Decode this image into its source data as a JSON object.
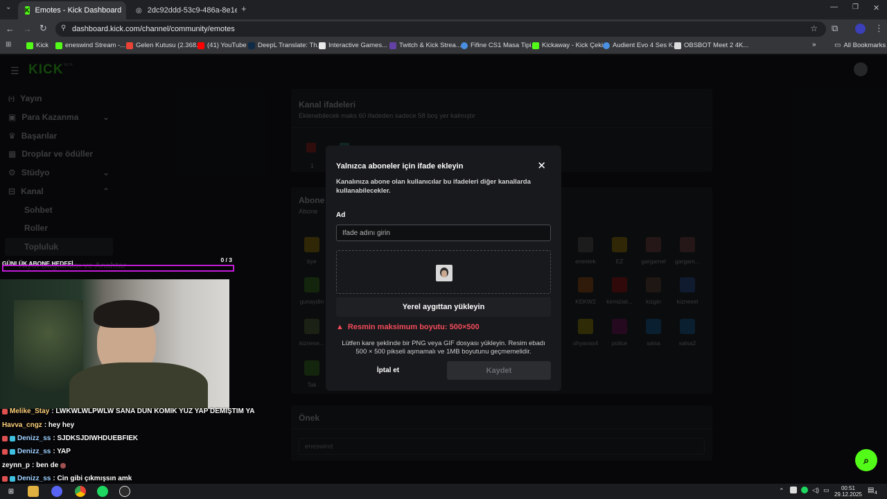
{
  "browser": {
    "tabs": [
      {
        "title": "Emotes - Kick Dashboard",
        "active": true
      },
      {
        "title": "2dc92ddd-53c9-486a-8e1e-22...",
        "active": false
      }
    ],
    "url": "dashboard.kick.com/channel/community/emotes",
    "bookmarks": [
      "Kick",
      "eneswind Stream -...",
      "Gelen Kutusu (2.368...",
      "(41) YouTube",
      "DeepL Translate: Th...",
      "Interactive Games...",
      "Twitch & Kick Strea...",
      "Fifine CS1 Masa Tipi...",
      "Kickaway - Kick Çeki...",
      "Audient Evo 4 Ses K...",
      "OBSBOT Meet 2 4K..."
    ],
    "all_bookmarks": "All Bookmarks"
  },
  "sidebar": {
    "logo": "KICK",
    "logo_tag": "BETA",
    "items": [
      {
        "label": "Yayın",
        "icon": "broadcast-icon"
      },
      {
        "label": "Para Kazanma",
        "icon": "money-icon"
      },
      {
        "label": "Başarılar",
        "icon": "trophy-icon"
      },
      {
        "label": "Droplar ve ödüller",
        "icon": "gift-icon"
      },
      {
        "label": "Stüdyo",
        "icon": "gear-icon"
      },
      {
        "label": "Kanal",
        "icon": "channel-icon"
      }
    ],
    "subitems": [
      "Sohbet",
      "Roller",
      "Topluluk",
      "Yayın Bağlantısı ve Anahtar"
    ]
  },
  "main": {
    "channel_emotes_title": "Kanal ifadeleri",
    "channel_emotes_sub": "Eklenebilecek maks 60 ifadeden sadece 58 boş yer kalmıştır",
    "first_emote_label": "1",
    "subscriber_title": "Abone",
    "subscriber_sub": "Abone",
    "emotes_left": [
      "bye",
      "gunaydin",
      "kiznese...",
      "Tak"
    ],
    "emotes_right_row1": [
      "enestek",
      "EZ",
      "gargamel",
      "gargam..."
    ],
    "emotes_right_row2": [
      "KEKW2",
      "kirmizial...",
      "kizgin",
      "kiznesel"
    ],
    "emotes_right_row3": [
      "ohyavas4",
      "police",
      "salsa",
      "salsa2"
    ],
    "prefix_title": "Önek",
    "prefix_value": "eneswind"
  },
  "modal": {
    "title": "Yalnızca aboneler için ifade ekleyin",
    "description": "Kanalınıza abone olan kullanıcılar bu ifadeleri diğer kanallarda kullanabilecekler.",
    "name_label": "Ad",
    "name_placeholder": "İfade adını girin",
    "upload_label": "Yerel aygıttan yükleyin",
    "error": "Resmin maksimum boyutu: 500×500",
    "hint": "Lütfen kare şeklinde bir PNG veya GIF dosyası yükleyin. Resim ebadı 500 × 500 pikseli aşmamalı ve 1MB boyutunu geçmemelidir.",
    "cancel": "İptal et",
    "save": "Kaydet"
  },
  "stream": {
    "goal_label": "GÜNLÜK ABONE HEDEFİ",
    "goal_count": "0 / 3",
    "goal_progress": 0,
    "chat": [
      {
        "user": "Melike_Stay",
        "msg": ": LWKWLWLPWLW SANA DUN KOMIK YUZ YAP DEMIŞTIM YA",
        "color": "#ffd27a"
      },
      {
        "user": "Havva_cngz",
        "msg": ": hey hey",
        "color": "#ffd27a"
      },
      {
        "user": "Denizz_ss",
        "msg": ": SJDKSJDIWHDUEBFIEK",
        "color": "#9fd0ff"
      },
      {
        "user": "Denizz_ss",
        "msg": ": YAP",
        "color": "#9fd0ff"
      },
      {
        "user": "zeynn_p",
        "msg": ": ben de",
        "color": "#ffffff"
      },
      {
        "user": "Denizz_ss",
        "msg": ": Cin gibi çıkmışsın amk",
        "color": "#9fd0ff"
      }
    ]
  },
  "taskbar": {
    "time": "00:51",
    "date": "29.12.2025",
    "notif": "4"
  },
  "colors": {
    "brand": "#53fc18",
    "error": "#f24b5a",
    "goal_border": "#c21bd6"
  }
}
